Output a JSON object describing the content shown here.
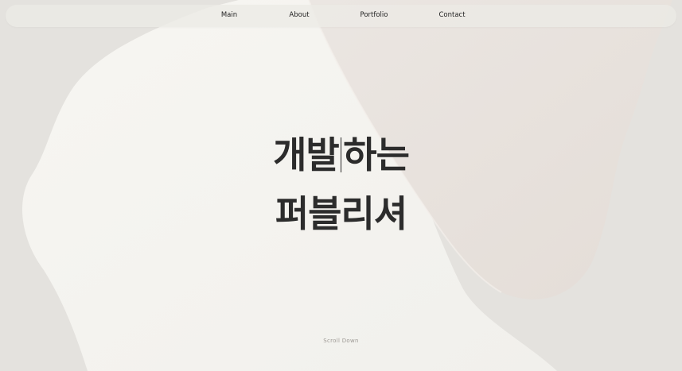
{
  "nav": {
    "items": [
      {
        "label": "Main"
      },
      {
        "label": "About"
      },
      {
        "label": "Portfolio"
      },
      {
        "label": "Contact"
      }
    ]
  },
  "hero": {
    "line1_before_cursor": "개발",
    "line1_after_cursor": "하는",
    "line2": "퍼블리셔"
  },
  "scroll": {
    "label": "Scroll Down"
  },
  "colors": {
    "background": "#e4e2de",
    "blob_light": "#f4f3ef",
    "blob_beige": "#e8e1dc",
    "text": "#2c2c2c"
  }
}
